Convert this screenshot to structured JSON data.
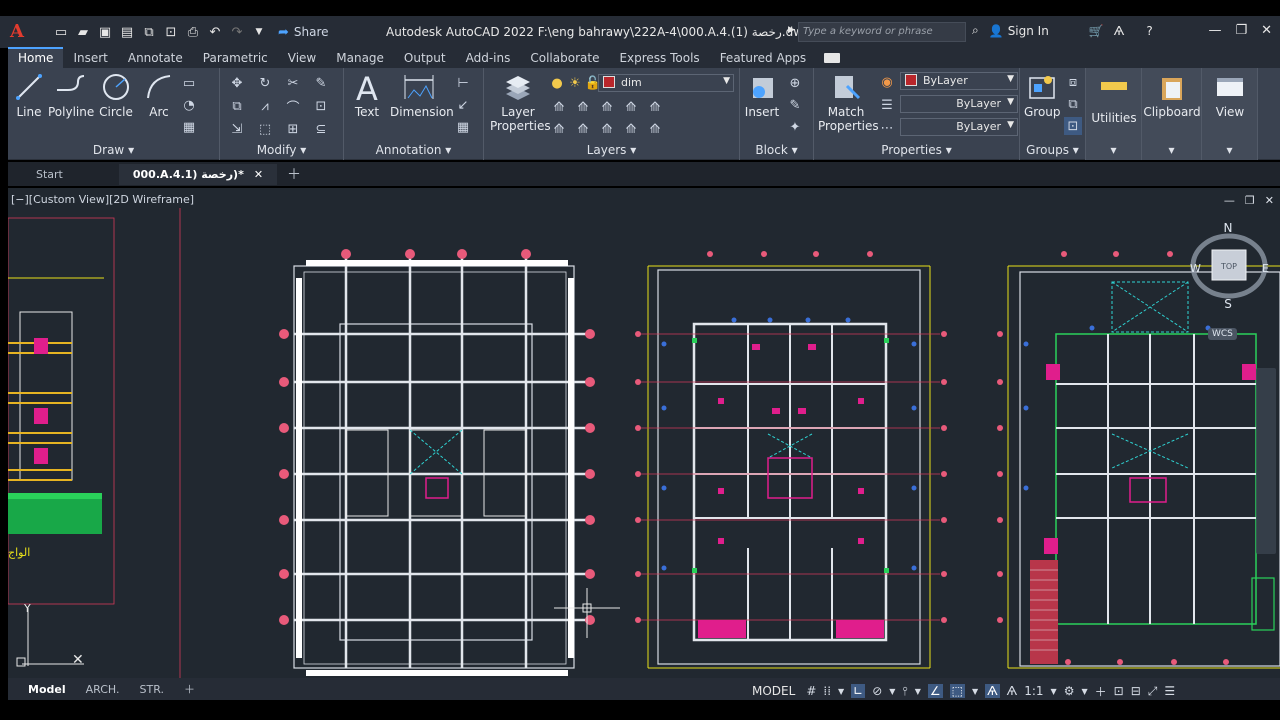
{
  "titlebar": {
    "app_logo": "A",
    "share_label": "Share",
    "title": "Autodesk AutoCAD 2022   F:\\eng bahrawy\\222A-4\\000.A.4.رخصة (1).dwg",
    "search_placeholder": "Type a keyword or phrase",
    "sign_in": "Sign In"
  },
  "ribbon_tabs": [
    "Home",
    "Insert",
    "Annotate",
    "Parametric",
    "View",
    "Manage",
    "Output",
    "Add-ins",
    "Collaborate",
    "Express Tools",
    "Featured Apps"
  ],
  "panels": {
    "draw": {
      "title": "Draw",
      "tools": [
        "Line",
        "Polyline",
        "Circle",
        "Arc"
      ]
    },
    "modify": {
      "title": "Modify"
    },
    "annotation": {
      "title": "Annotation",
      "tools": [
        "Text",
        "Dimension"
      ]
    },
    "layers": {
      "title": "Layers",
      "tool": "Layer Properties",
      "current_layer": "dim"
    },
    "block": {
      "title": "Block",
      "tool": "Insert"
    },
    "properties": {
      "title": "Properties",
      "tool": "Match Properties",
      "color": "ByLayer",
      "linetype": "ByLayer",
      "lineweight": "ByLayer"
    },
    "groups": {
      "title": "Groups",
      "tool": "Group"
    },
    "utilities": {
      "title": "Utilities"
    },
    "clipboard": {
      "title": "Clipboard"
    },
    "view": {
      "title": "View"
    }
  },
  "doc_tabs": {
    "start": "Start",
    "active": "000.A.4.1) رخصة)*"
  },
  "viewport": {
    "label": "[−][Custom View][2D Wireframe]",
    "viewcube": {
      "n": "N",
      "s": "S",
      "w": "W",
      "e": "E",
      "top": "TOP"
    },
    "wcs": "WCS",
    "arabic_label": "الواج",
    "ucs_y": "Y"
  },
  "layout_tabs": [
    "Model",
    "ARCH.",
    "STR."
  ],
  "status": {
    "model": "MODEL",
    "scale": "1:1"
  },
  "colors": {
    "accent": "#4da3ff",
    "ribbon_bg": "#3a4250",
    "canvas_bg": "#212830",
    "layer_swatch": "#b8262b"
  }
}
